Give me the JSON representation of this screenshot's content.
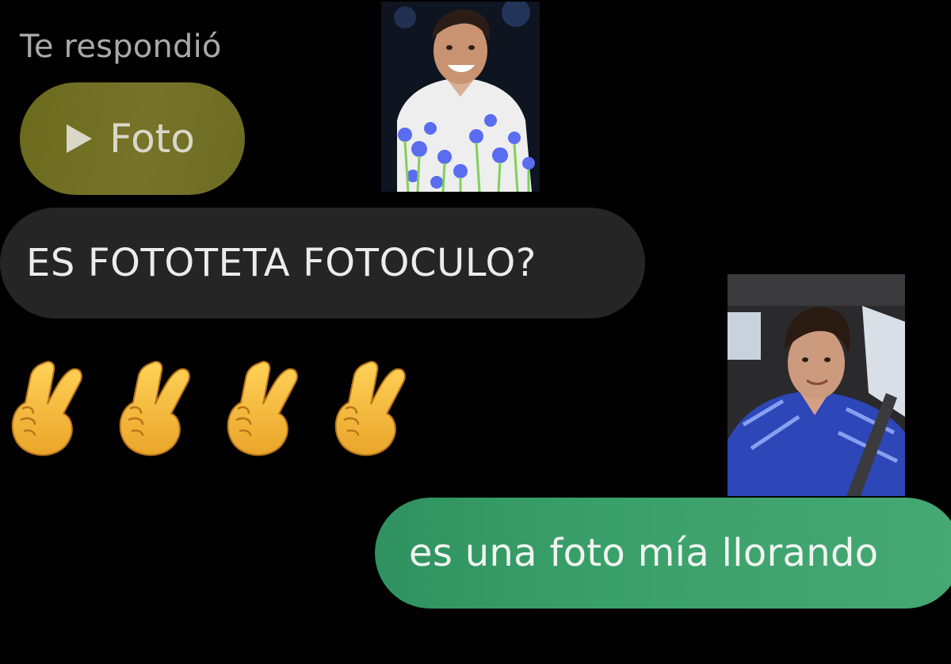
{
  "reply_header": {
    "caption": "Te respondió",
    "attachment_label": "Foto",
    "attachment_icon": "play-icon"
  },
  "messages": [
    {
      "direction": "incoming",
      "text": "ES FOTOTETA FOTOCULO?"
    },
    {
      "direction": "incoming",
      "emoji": "crossed-fingers",
      "count": 4
    },
    {
      "direction": "outgoing",
      "text": "es una foto mía llorando"
    }
  ],
  "overlay_photos": [
    "smiling-man-with-blue-flowers-photo",
    "man-in-blue-jersey-car-selfie-photo"
  ],
  "colors": {
    "background": "#000000",
    "photo_reply_bubble": "#73712a",
    "incoming_bubble": "#252525",
    "outgoing_bubble": "#3aa06a",
    "caption_text": "#a9a9a9"
  }
}
